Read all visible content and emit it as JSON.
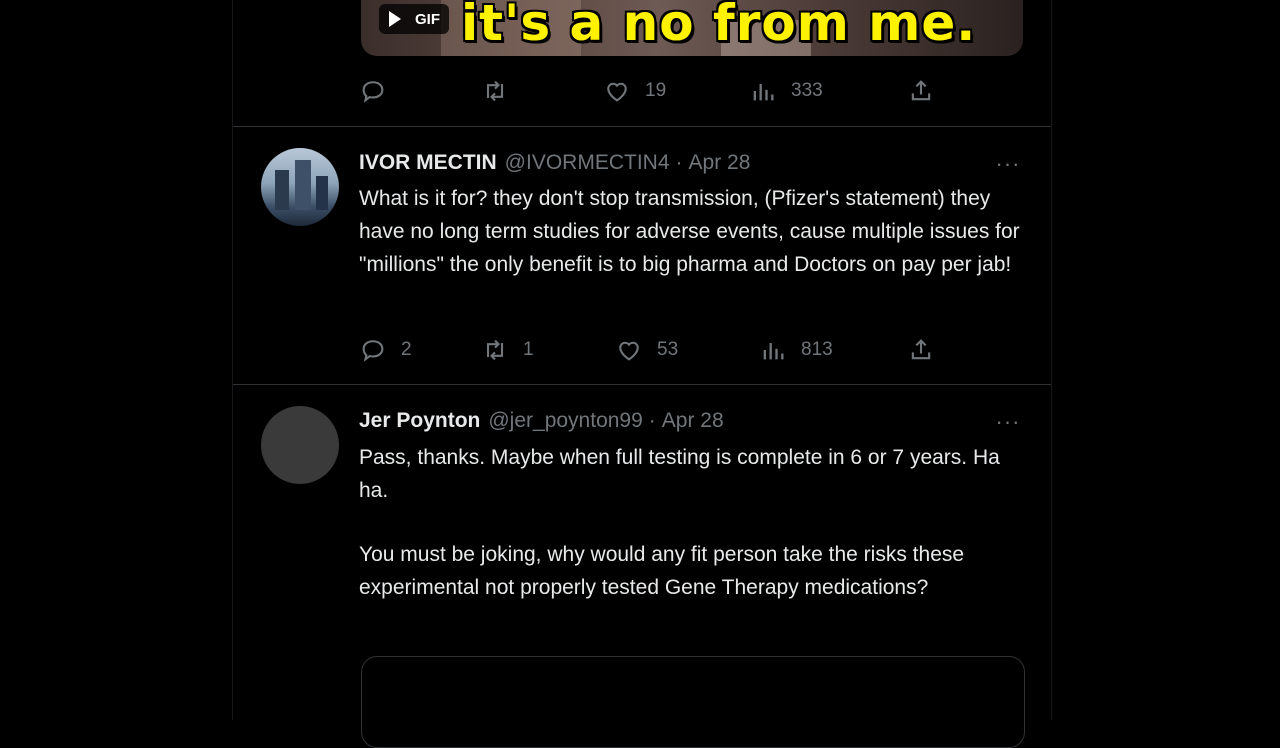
{
  "gif": {
    "caption": "it's a no from me.",
    "badge_label": "GIF"
  },
  "tweet0": {
    "actions": {
      "reply_count": "",
      "retweet_count": "",
      "like_count": "19",
      "views_count": "333"
    }
  },
  "tweet1": {
    "name": "IVOR MECTIN",
    "handle": "@IVORMECTIN4",
    "sep": "·",
    "date": "Apr 28",
    "text": "What is it for? they don't stop transmission, (Pfizer's statement) they have no long term studies for adverse events, cause multiple issues for \"millions\" the only benefit is to big pharma and Doctors on pay per jab!",
    "actions": {
      "reply_count": "2",
      "retweet_count": "1",
      "like_count": "53",
      "views_count": "813"
    }
  },
  "tweet2": {
    "name": "Jer Poynton",
    "handle": "@jer_poynton99",
    "sep": "·",
    "date": "Apr 28",
    "paragraph1": "Pass, thanks. Maybe when full testing is complete in 6 or 7 years. Ha ha.",
    "paragraph2": "You must be joking, why would any fit person take the risks these experimental not properly tested Gene Therapy medications?"
  },
  "more_label": "···"
}
